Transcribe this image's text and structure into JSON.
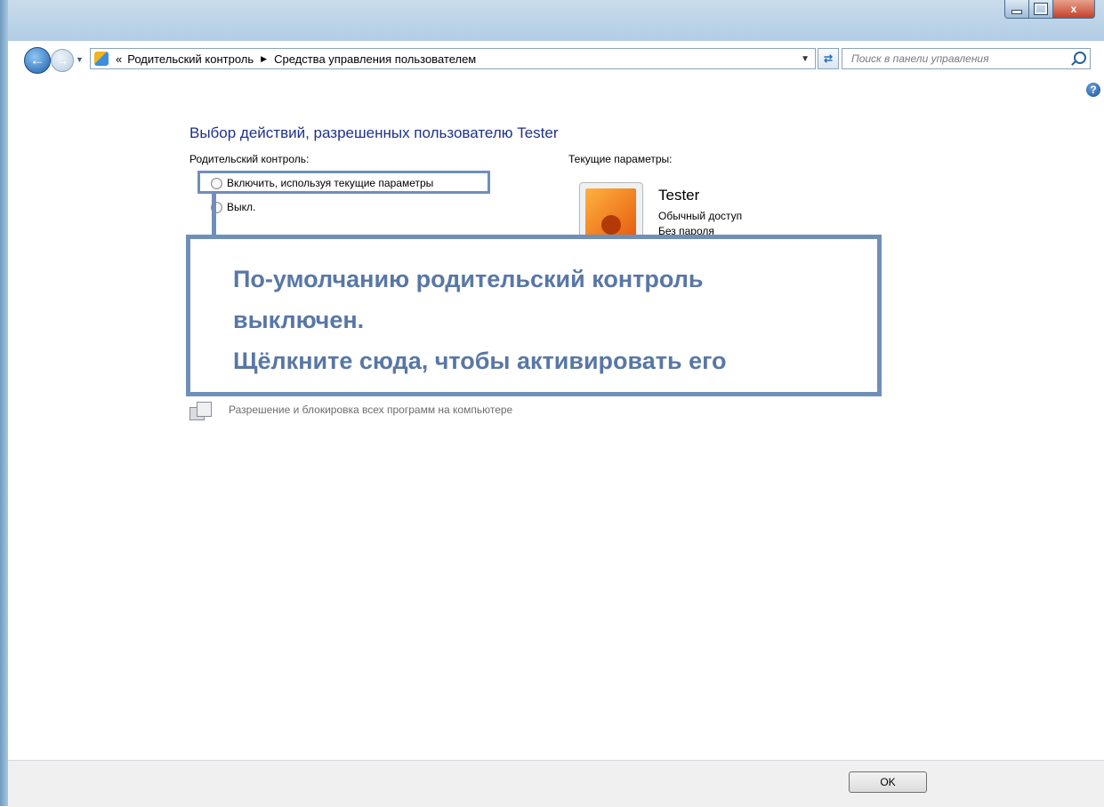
{
  "window": {
    "controls": {
      "minimize": "",
      "maximize": "",
      "close": "x"
    }
  },
  "nav": {
    "breadcrumb_prefix": "«",
    "breadcrumb": [
      {
        "label": "Родительский контроль",
        "sep": "▶"
      },
      {
        "label": "Средства управления пользователем"
      }
    ],
    "search_placeholder": "Поиск в панели управления",
    "icons": [
      "back-arrow-icon",
      "forward-arrow-icon",
      "control-panel-icon",
      "refresh-icon",
      "search-icon",
      "help-icon"
    ]
  },
  "main": {
    "heading": "Выбор действий, разрешенных пользователю Tester",
    "parental_label": "Родительский контроль:",
    "options": [
      {
        "label": "Включить, используя текущие параметры",
        "selected": false
      },
      {
        "label": "Выкл.",
        "selected": true
      }
    ],
    "current_label": "Текущие параметры:",
    "user": {
      "name": "Tester",
      "account_type": "Обычный доступ",
      "password": "Без пароля"
    },
    "programs_text": "Разрешение и блокировка всех программ на компьютере"
  },
  "callout": {
    "line1": "По-умолчанию родительский контроль",
    "line2": "выключен.",
    "line3": "Щёлкните сюда, чтобы активировать его"
  },
  "footer": {
    "ok_label": "OK"
  },
  "colors": {
    "annotation": "#6f8fb9",
    "heading": "#1e3287",
    "callout_text": "#5877a6"
  }
}
